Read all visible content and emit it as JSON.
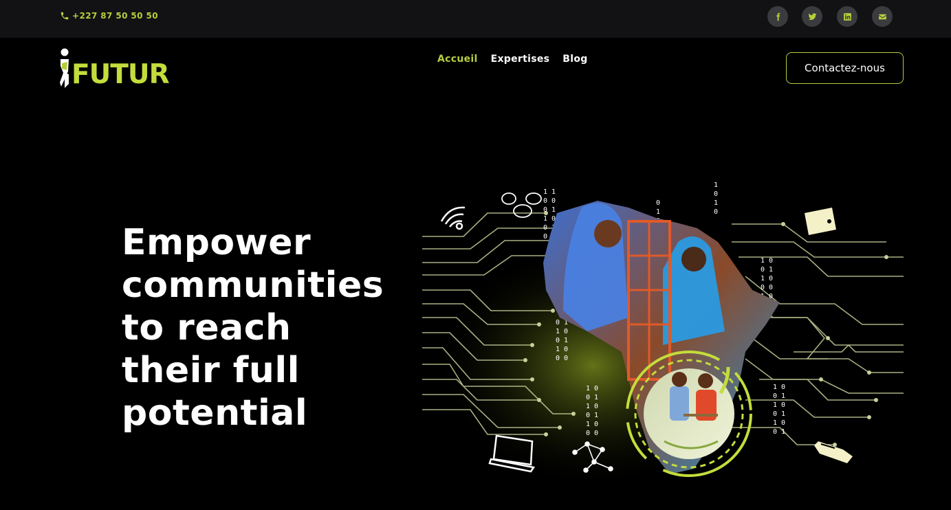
{
  "topbar": {
    "phone": "+227 87 50 50 50",
    "social": [
      {
        "name": "facebook-icon"
      },
      {
        "name": "twitter-icon"
      },
      {
        "name": "linkedin-icon"
      },
      {
        "name": "email-icon"
      }
    ]
  },
  "header": {
    "logo_text": "FUTUR",
    "nav": [
      {
        "label": "Accueil",
        "active": true
      },
      {
        "label": "Expertises",
        "active": false
      },
      {
        "label": "Blog",
        "active": false
      }
    ],
    "cta_label": "Contactez-nous"
  },
  "hero": {
    "title_lines": [
      "Empower",
      "communities",
      "to reach",
      "their full",
      "potential"
    ]
  },
  "colors": {
    "accent": "#b5cf3c",
    "topbar_bg": "#121214",
    "page_bg": "#000000",
    "social_bg": "#3a3b3e"
  }
}
